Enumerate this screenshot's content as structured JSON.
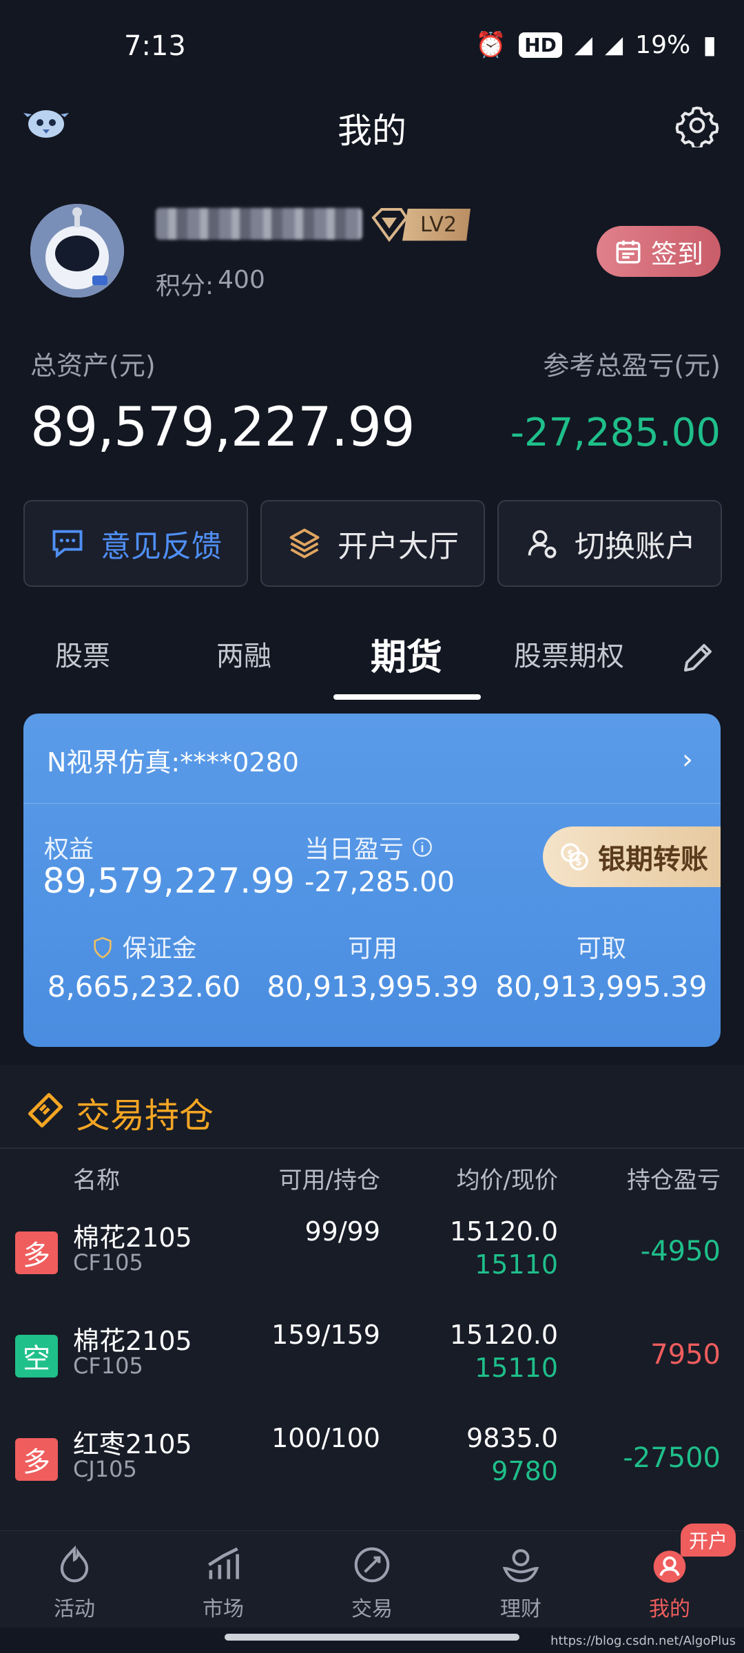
{
  "status_bar": {
    "time": "7:13",
    "hd": "HD",
    "network": "4G",
    "battery": "19%"
  },
  "header": {
    "title": "我的"
  },
  "profile": {
    "points_label": "积分:",
    "points_value": "400",
    "level": "LV2",
    "checkin_label": "签到"
  },
  "assets": {
    "total_label": "总资产(元)",
    "total_value": "89,579,227.99",
    "pl_label": "参考总盈亏(元)",
    "pl_value": "-27,285.00"
  },
  "actions": {
    "feedback": "意见反馈",
    "account_hall": "开户大厅",
    "switch_account": "切换账户"
  },
  "tabs": [
    "股票",
    "两融",
    "期货",
    "股票期权"
  ],
  "active_tab": "期货",
  "account_card": {
    "name": "N视界仿真:",
    "number": "****0280",
    "equity_label": "权益",
    "equity_value": "89,579,227.99",
    "daily_pl_label": "当日盈亏",
    "daily_pl_value": "-27,285.00",
    "transfer_label": "银期转账",
    "margin_label": "保证金",
    "margin_value": "8,665,232.60",
    "available_label": "可用",
    "available_value": "80,913,995.39",
    "withdrawable_label": "可取",
    "withdrawable_value": "80,913,995.39"
  },
  "positions": {
    "title": "交易持仓",
    "headers": {
      "name": "名称",
      "qty": "可用/持仓",
      "price": "均价/现价",
      "pl": "持仓盈亏"
    },
    "rows": [
      {
        "direction": "多",
        "name": "棉花2105",
        "code": "CF105",
        "qty": "99/99",
        "avg": "15120.0",
        "last": "15110",
        "pl": "-4950",
        "pl_sign": "neg"
      },
      {
        "direction": "空",
        "name": "棉花2105",
        "code": "CF105",
        "qty": "159/159",
        "avg": "15120.0",
        "last": "15110",
        "pl": "7950",
        "pl_sign": "pos"
      },
      {
        "direction": "多",
        "name": "红枣2105",
        "code": "CJ105",
        "qty": "100/100",
        "avg": "9835.0",
        "last": "9780",
        "pl": "-27500",
        "pl_sign": "neg"
      }
    ]
  },
  "bottom_nav": {
    "items": [
      "活动",
      "市场",
      "交易",
      "理财",
      "我的"
    ],
    "active": "我的",
    "badge": "开户"
  },
  "watermark": "https://blog.csdn.net/AlgoPlus"
}
